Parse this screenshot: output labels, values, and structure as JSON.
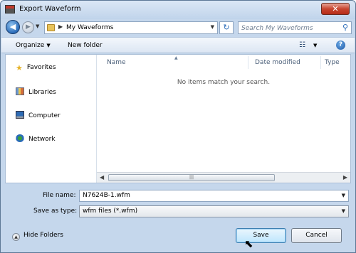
{
  "window": {
    "title": "Export Waveform",
    "close_glyph": "✕"
  },
  "nav": {
    "back_glyph": "◀",
    "forward_glyph": "▶",
    "address": "My Waveforms",
    "search_placeholder": "Search My Waveforms"
  },
  "toolbar": {
    "organize_label": "Organize",
    "new_folder_label": "New folder"
  },
  "sidebar": {
    "items": [
      {
        "label": "Favorites",
        "icon": "star-icon"
      },
      {
        "label": "Libraries",
        "icon": "libraries-icon"
      },
      {
        "label": "Computer",
        "icon": "computer-icon"
      },
      {
        "label": "Network",
        "icon": "network-icon"
      }
    ]
  },
  "file_list": {
    "columns": [
      "Name",
      "Date modified",
      "Type"
    ],
    "empty_message": "No items match your search."
  },
  "form": {
    "file_name_label": "File name:",
    "file_name_value": "N7624B-1.wfm",
    "save_as_type_label": "Save as type:",
    "save_as_type_value": "wfm files (*.wfm)"
  },
  "footer": {
    "hide_folders_label": "Hide Folders",
    "save_label": "Save",
    "cancel_label": "Cancel"
  }
}
